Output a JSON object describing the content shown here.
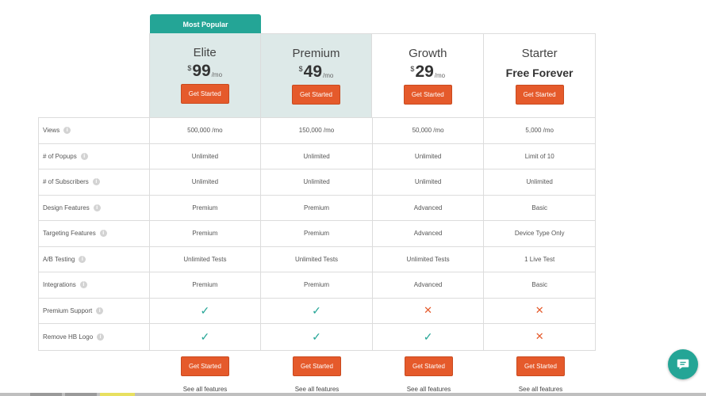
{
  "badge": "Most Popular",
  "plans": [
    {
      "name": "Elite",
      "currency": "$",
      "amount": "99",
      "period": "/mo",
      "cta": "Get Started"
    },
    {
      "name": "Premium",
      "currency": "$",
      "amount": "49",
      "period": "/mo",
      "cta": "Get Started"
    },
    {
      "name": "Growth",
      "currency": "$",
      "amount": "29",
      "period": "/mo",
      "cta": "Get Started"
    },
    {
      "name": "Starter",
      "free": "Free Forever",
      "cta": "Get Started"
    }
  ],
  "rows": [
    {
      "label": "Views",
      "values": [
        "500,000 /mo",
        "150,000 /mo",
        "50,000 /mo",
        "5,000 /mo"
      ]
    },
    {
      "label": "# of Popups",
      "values": [
        "Unlimited",
        "Unlimited",
        "Unlimited",
        "Limit of 10"
      ]
    },
    {
      "label": "# of Subscribers",
      "values": [
        "Unlimited",
        "Unlimited",
        "Unlimited",
        "Unlimited"
      ]
    },
    {
      "label": "Design Features",
      "values": [
        "Premium",
        "Premium",
        "Advanced",
        "Basic"
      ]
    },
    {
      "label": "Targeting Features",
      "values": [
        "Premium",
        "Premium",
        "Advanced",
        "Device Type Only"
      ]
    },
    {
      "label": "A/B Testing",
      "values": [
        "Unlimited Tests",
        "Unlimited Tests",
        "Unlimited Tests",
        "1 Live Test"
      ]
    },
    {
      "label": "Integrations",
      "values": [
        "Premium",
        "Premium",
        "Advanced",
        "Basic"
      ]
    },
    {
      "label": "Premium Support",
      "values": [
        "check",
        "check",
        "cross",
        "cross"
      ]
    },
    {
      "label": "Remove HB Logo",
      "values": [
        "check",
        "check",
        "check",
        "cross"
      ]
    }
  ],
  "footer": {
    "cta": "Get Started",
    "see_all": "See all features"
  },
  "icons": {
    "info": "info-icon",
    "check": "check-icon",
    "cross": "cross-icon",
    "chat": "chat-icon"
  },
  "colors": {
    "accent": "#24a596",
    "cta": "#e55a2b",
    "highlight": "#dde9e8"
  }
}
